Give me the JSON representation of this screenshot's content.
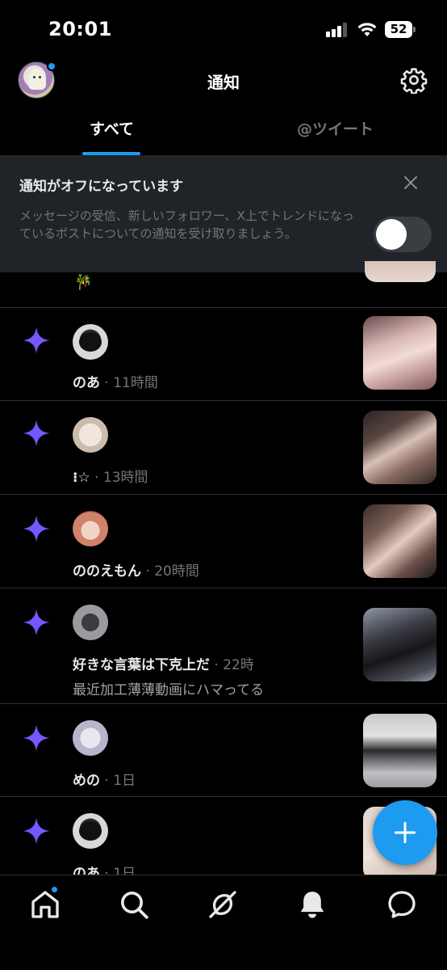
{
  "status": {
    "time": "20:01",
    "battery": "52"
  },
  "header": {
    "title": "通知"
  },
  "tabs": [
    {
      "label": "すべて"
    },
    {
      "label": "@ツイート"
    }
  ],
  "banner": {
    "title": "通知がオフになっています",
    "text": "メッセージの受信、新しいフォロワー、X上でトレンドになっているポストについての通知を受け取りましょう。"
  },
  "partial": {
    "emoji": "🎋"
  },
  "notifications": [
    {
      "name": "のあ",
      "time": "· 11時間",
      "sub": ""
    },
    {
      "name": "⁝☆",
      "time": "· 13時間",
      "sub": ""
    },
    {
      "name": "ののえもん",
      "time": "· 20時間",
      "sub": ""
    },
    {
      "name": "好きな言葉は下克上だ",
      "time": "· 22時",
      "sub": "最近加工薄薄動画にハマってる"
    },
    {
      "name": "めの",
      "time": "· 1日",
      "sub": ""
    },
    {
      "name": "のあ",
      "time": "· 1日",
      "sub": ""
    }
  ],
  "colors": {
    "accent": "#1d9bf0",
    "sparkle": "#7856ff",
    "background": "#000000",
    "banner": "#202327"
  },
  "icons": {
    "header_right": "gear-icon",
    "banner_close": "close-icon",
    "row_marker": "sparkle-icon",
    "fab": "plus-icon",
    "nav": [
      "home-icon",
      "search-icon",
      "grok-icon",
      "bell-icon",
      "message-icon"
    ]
  }
}
